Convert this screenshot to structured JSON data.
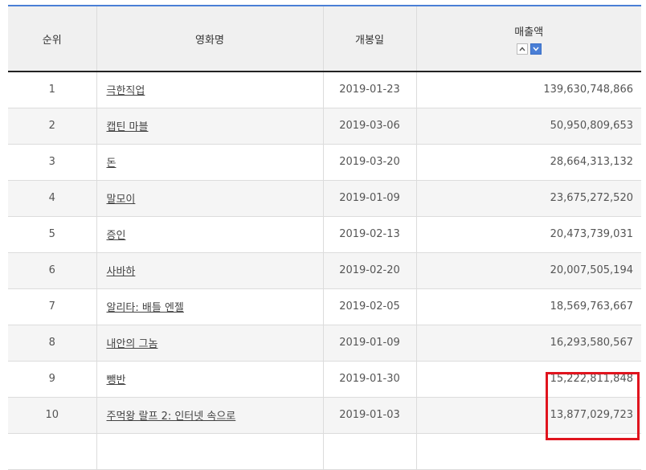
{
  "table": {
    "headers": {
      "rank": "순위",
      "title": "영화명",
      "release_date": "개봉일",
      "sales": "매출액"
    },
    "sort": {
      "asc_icon": "chevron-up-icon",
      "desc_icon": "chevron-down-icon",
      "active": "desc"
    },
    "rows": [
      {
        "rank": "1",
        "title": "극한직업",
        "date": "2019-01-23",
        "sales": "139,630,748,866"
      },
      {
        "rank": "2",
        "title": "캡틴 마블",
        "date": "2019-03-06",
        "sales": "50,950,809,653"
      },
      {
        "rank": "3",
        "title": "돈",
        "date": "2019-03-20",
        "sales": "28,664,313,132"
      },
      {
        "rank": "4",
        "title": "말모이",
        "date": "2019-01-09",
        "sales": "23,675,272,520"
      },
      {
        "rank": "5",
        "title": "증인",
        "date": "2019-02-13",
        "sales": "20,473,739,031"
      },
      {
        "rank": "6",
        "title": "사바하",
        "date": "2019-02-20",
        "sales": "20,007,505,194"
      },
      {
        "rank": "7",
        "title": "알리타: 배틀 엔젤",
        "date": "2019-02-05",
        "sales": "18,569,763,667"
      },
      {
        "rank": "8",
        "title": "내안의 그놈",
        "date": "2019-01-09",
        "sales": "16,293,580,567"
      },
      {
        "rank": "9",
        "title": "뺑반",
        "date": "2019-01-30",
        "sales": "15,222,811,848"
      },
      {
        "rank": "10",
        "title": "주먹왕 랄프 2: 인터넷 속으로",
        "date": "2019-01-03",
        "sales": "13,877,029,723"
      },
      {
        "rank": "",
        "title": "",
        "date": "",
        "sales": ""
      }
    ]
  },
  "colors": {
    "header_top_border": "#4a7fd6",
    "highlight": "#e0141e",
    "sort_active": "#4a7fd6"
  }
}
